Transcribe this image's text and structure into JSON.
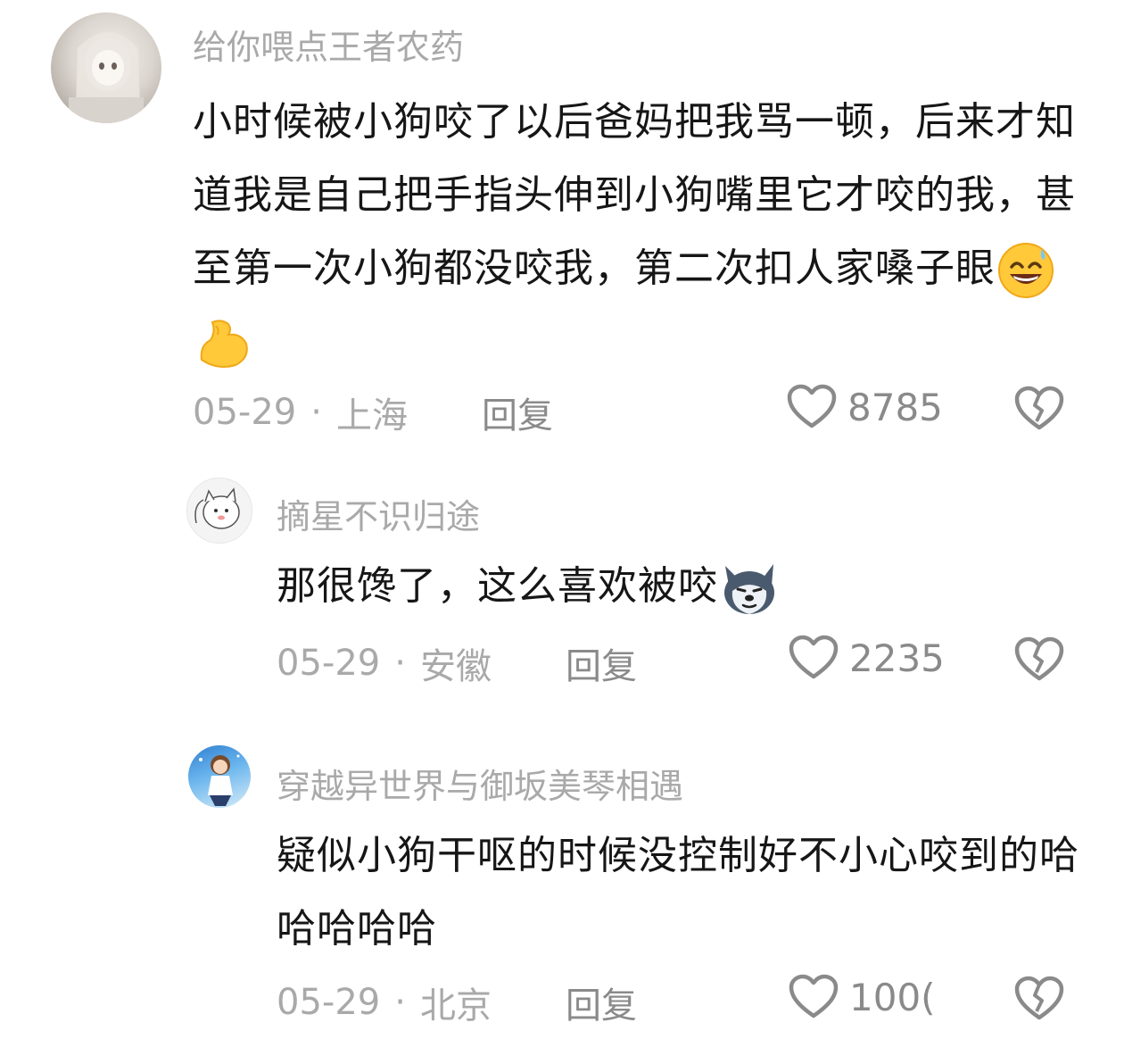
{
  "comments": [
    {
      "username": "给你喂点王者农药",
      "content_text": "小时候被小狗咬了以后爸妈把我骂一顿，后来才知道我是自己把手指头伸到小狗嘴里它才咬的我，甚至第一次小狗都没咬我，第二次扣人家嗓子眼",
      "emojis": [
        "grinning-sweat-emoji",
        "flexed-biceps-emoji"
      ],
      "date": "05-29",
      "separator": "·",
      "location": "上海",
      "reply_label": "回复",
      "likes": "8785"
    },
    {
      "username": "摘星不识归途",
      "content_text": "那很馋了，这么喜欢被咬",
      "emojis": [
        "husky-dog-emoji"
      ],
      "date": "05-29",
      "separator": "·",
      "location": "安徽",
      "reply_label": "回复",
      "likes": "2235"
    },
    {
      "username": "穿越异世界与御坂美琴相遇",
      "content_text": "疑似小狗干呕的时候没控制好不小心咬到的哈哈哈哈哈",
      "emojis": [],
      "date": "05-29",
      "separator": "·",
      "location": "北京",
      "reply_label": "回复",
      "likes": "100("
    }
  ],
  "colors": {
    "username": "#a9a9a9",
    "content": "#161616",
    "meta": "#a9a9a9",
    "icon": "#8a8a8a"
  }
}
